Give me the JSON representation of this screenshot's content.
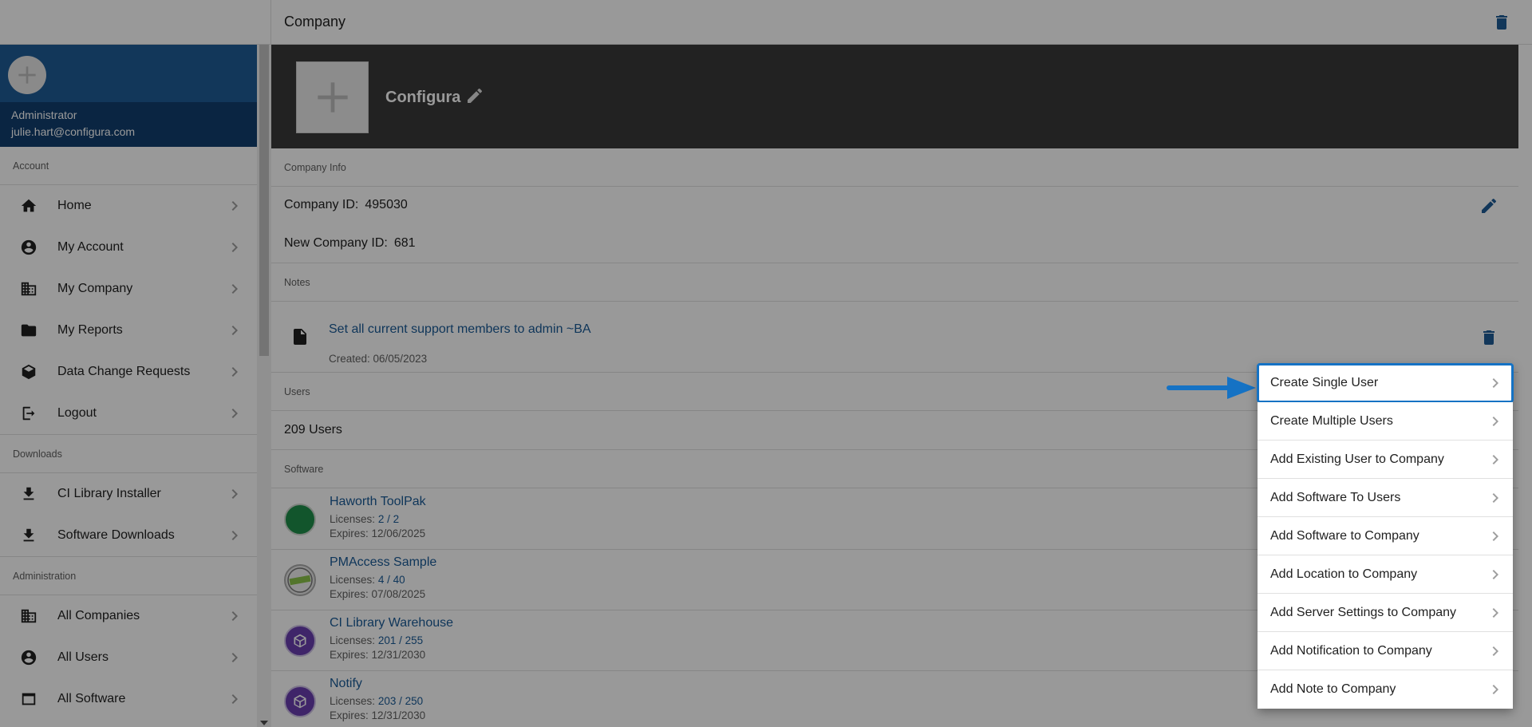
{
  "sidebar": {
    "profile": {
      "role": "Administrator",
      "email": "julie.hart@configura.com",
      "avatar_icon": "plus-icon"
    },
    "sections": [
      {
        "title": "Account",
        "items": [
          {
            "label": "Home",
            "icon": "home-icon"
          },
          {
            "label": "My Account",
            "icon": "account-circle-icon"
          },
          {
            "label": "My Company",
            "icon": "building-icon"
          },
          {
            "label": "My Reports",
            "icon": "folder-icon"
          },
          {
            "label": "Data Change Requests",
            "icon": "cube-icon"
          },
          {
            "label": "Logout",
            "icon": "logout-icon"
          }
        ]
      },
      {
        "title": "Downloads",
        "items": [
          {
            "label": "CI Library Installer",
            "icon": "download-icon"
          },
          {
            "label": "Software Downloads",
            "icon": "download-icon"
          }
        ]
      },
      {
        "title": "Administration",
        "items": [
          {
            "label": "All Companies",
            "icon": "building-icon"
          },
          {
            "label": "All Users",
            "icon": "account-circle-icon"
          },
          {
            "label": "All Software",
            "icon": "window-icon"
          }
        ]
      }
    ]
  },
  "header": {
    "title": "Company"
  },
  "banner": {
    "company_name": "Configura"
  },
  "company_info": {
    "section_title": "Company Info",
    "company_id_label": "Company ID:",
    "company_id": "495030",
    "new_company_id_label": "New Company ID:",
    "new_company_id": "681"
  },
  "notes": {
    "section_title": "Notes",
    "text": "Set all current support members to admin ~BA",
    "created": "Created: 06/05/2023"
  },
  "users": {
    "section_title": "Users",
    "count_text": "209 Users"
  },
  "software": {
    "section_title": "Software",
    "licenses_label": "Licenses:",
    "items": [
      {
        "name": "Haworth ToolPak",
        "licenses": "2 / 2",
        "expires": "Expires: 12/06/2025",
        "icon": "green-circle-icon"
      },
      {
        "name": "PMAccess Sample",
        "licenses": "4 / 40",
        "expires": "Expires: 07/08/2025",
        "icon": "sample-badge-icon"
      },
      {
        "name": "CI Library Warehouse",
        "licenses": "201 / 255",
        "expires": "Expires: 12/31/2030",
        "icon": "purple-box-icon"
      },
      {
        "name": "Notify",
        "licenses": "203 / 250",
        "expires": "Expires: 12/31/2030",
        "icon": "purple-box-icon"
      }
    ]
  },
  "menu": {
    "items": [
      "Create Single User",
      "Create Multiple Users",
      "Add Existing User to Company",
      "Add Software To Users",
      "Add Software to Company",
      "Add Location to Company",
      "Add Server Settings to Company",
      "Add Notification to Company",
      "Add Note to Company"
    ],
    "highlighted_index": 0
  },
  "colors": {
    "brand": "#1f5d96",
    "brand_dark": "#123f6e",
    "link": "#1a5a96",
    "highlight": "#1572c4"
  }
}
